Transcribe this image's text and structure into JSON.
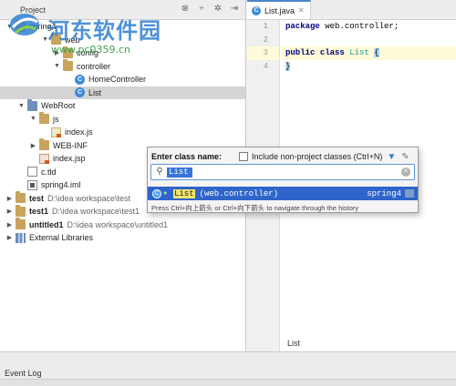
{
  "project_panel": {
    "title": "Project",
    "tree": [
      {
        "label": "spring4",
        "path": "",
        "indent": 0,
        "arrow": "down",
        "icon": "folder-icon"
      },
      {
        "label": "web",
        "path": "",
        "indent": 3,
        "arrow": "down",
        "icon": "package-icon"
      },
      {
        "label": "config",
        "path": "",
        "indent": 4,
        "arrow": "right",
        "icon": "package-icon"
      },
      {
        "label": "controller",
        "path": "",
        "indent": 4,
        "arrow": "down",
        "icon": "package-icon"
      },
      {
        "label": "HomeController",
        "path": "",
        "indent": 5,
        "arrow": "none",
        "icon": "class-icon"
      },
      {
        "label": "List",
        "path": "",
        "indent": 5,
        "arrow": "none",
        "icon": "class-icon",
        "selected": true
      },
      {
        "label": "WebRoot",
        "path": "",
        "indent": 1,
        "arrow": "down",
        "icon": "web-folder-icon"
      },
      {
        "label": "js",
        "path": "",
        "indent": 2,
        "arrow": "down",
        "icon": "folder-icon"
      },
      {
        "label": "index.js",
        "path": "",
        "indent": 3,
        "arrow": "none",
        "icon": "js-file-icon"
      },
      {
        "label": "WEB-INF",
        "path": "",
        "indent": 2,
        "arrow": "right",
        "icon": "folder-icon"
      },
      {
        "label": "index.jsp",
        "path": "",
        "indent": 2,
        "arrow": "none",
        "icon": "jsp-file-icon"
      },
      {
        "label": "c.tld",
        "path": "",
        "indent": 1,
        "arrow": "none",
        "icon": "tld-file-icon"
      },
      {
        "label": "spring4.iml",
        "path": "",
        "indent": 1,
        "arrow": "none",
        "icon": "iml-file-icon"
      },
      {
        "label": "test",
        "path": "D:\\idea workspace\\test",
        "indent": 0,
        "arrow": "right",
        "icon": "module-icon",
        "bold": true
      },
      {
        "label": "test1",
        "path": "D:\\idea workspace\\test1",
        "indent": 0,
        "arrow": "right",
        "icon": "module-icon",
        "bold": true
      },
      {
        "label": "untitled1",
        "path": "D:\\idea workspace\\untitled1",
        "indent": 0,
        "arrow": "right",
        "icon": "module-icon",
        "bold": true
      },
      {
        "label": "External Libraries",
        "path": "",
        "indent": 0,
        "arrow": "right",
        "icon": "library-icon"
      }
    ]
  },
  "editor": {
    "tab_label": "List.java",
    "line_numbers": [
      "1",
      "2",
      "3",
      "4"
    ],
    "code": {
      "line1_kw": "package",
      "line1_rest": " web.controller;",
      "line3_kw1": "public",
      "line3_kw2": "class",
      "line3_name": "List",
      "line3_brace": "{",
      "line4_brace": "}"
    },
    "status_label": "List"
  },
  "popup": {
    "title": "Enter class name:",
    "checkbox_label": "Include non-project classes (Ctrl+N)",
    "search_value": "List",
    "result_name": "List",
    "result_package": "(web.controller)",
    "result_module": "spring4",
    "hint": "Press Ctrl+向上箭头 or Ctrl+向下箭头 to navigate through the history"
  },
  "bottom": {
    "event_log": "Event Log"
  },
  "watermark": {
    "brand": "河东软件园",
    "url": "www.pc0359.cn"
  },
  "colors": {
    "accent": "#2f65ca",
    "selection": "#d4d4d4",
    "keyword": "#000080",
    "class_name": "#20999d",
    "watermark_blue": "#2f80d3",
    "watermark_green": "#2b9a3b"
  }
}
